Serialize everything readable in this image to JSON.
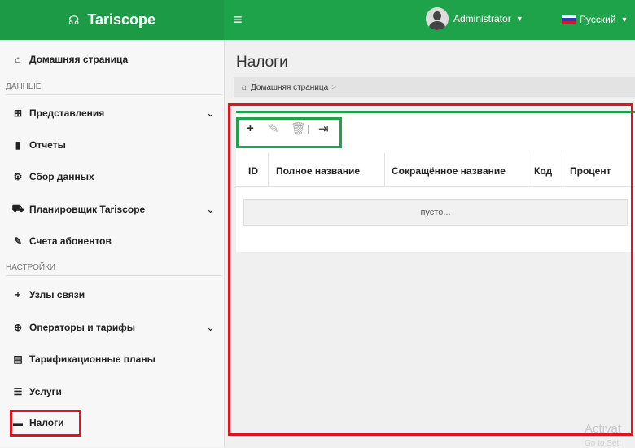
{
  "app": {
    "name": "Tariscope"
  },
  "header": {
    "menu_icon": "hamburger-icon",
    "user_name": "Administrator",
    "language": "Русский",
    "flag_colors": [
      "#ffffff",
      "#1c3fc4",
      "#e0141e"
    ]
  },
  "sidebar": {
    "home": {
      "label": "Домашняя страница",
      "icon": "home-icon"
    },
    "section_data": "ДАННЫЕ",
    "section_settings": "НАСТРОЙКИ",
    "items": [
      {
        "label": "Представления",
        "icon": "table-icon",
        "expandable": true
      },
      {
        "label": "Отчеты",
        "icon": "file-icon",
        "expandable": false
      },
      {
        "label": "Сбор данных",
        "icon": "cogs-icon",
        "expandable": false
      },
      {
        "label": "Планировщик Tariscope",
        "icon": "scheduler-icon",
        "expandable": true
      },
      {
        "label": "Счета абонентов",
        "icon": "invoice-icon",
        "expandable": false
      },
      {
        "label": "Узлы связи",
        "icon": "plus-icon",
        "expandable": false
      },
      {
        "label": "Операторы и тарифы",
        "icon": "globe-icon",
        "expandable": true
      },
      {
        "label": "Тарификационные планы",
        "icon": "list-box-icon",
        "expandable": false
      },
      {
        "label": "Услуги",
        "icon": "list-icon",
        "expandable": false
      },
      {
        "label": "Налоги",
        "icon": "card-icon",
        "expandable": false,
        "active": true
      }
    ]
  },
  "main": {
    "title": "Налоги",
    "breadcrumb": {
      "home": "Домашняя страница",
      "separator": ">"
    },
    "toolbar": {
      "add_icon": "plus-icon",
      "edit_icon": "pencil-icon",
      "delete_icon": "trash-icon",
      "divider": "|",
      "export_icon": "export-icon"
    },
    "table": {
      "columns": [
        "ID",
        "Полное название",
        "Сокращённое название",
        "Код",
        "Процент"
      ],
      "empty_text": "пусто..."
    }
  },
  "watermark": {
    "line1": "Activat",
    "line2": "Go to Sett"
  },
  "colors": {
    "header_green": "#1fa34a",
    "annotation_red": "#e0141e",
    "annotation_green": "#1fa34a"
  }
}
